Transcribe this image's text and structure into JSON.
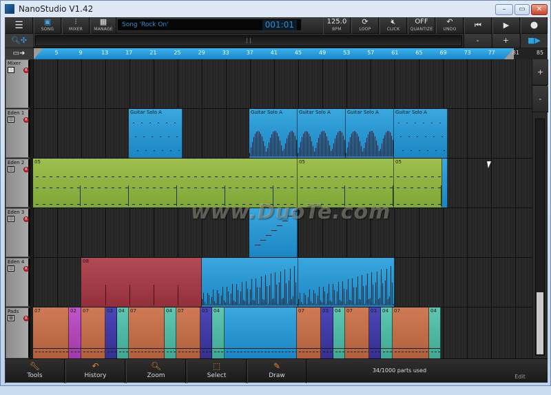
{
  "window": {
    "title": "NanoStudio V1.42",
    "controls": {
      "minimize": "–",
      "maximize": "▭",
      "close": "✕"
    }
  },
  "toolbar": {
    "menu_icon": "☰",
    "song": {
      "icon": "song-icon",
      "label": "SONG"
    },
    "mixer": {
      "icon": "mixer-icon",
      "label": "MIXER"
    },
    "manage": {
      "icon": "manage-icon",
      "label": "MANAGE"
    },
    "song_name": "Song 'Rock On'",
    "position": "001:01",
    "bpm_value": "125.0",
    "bpm_label": "BPM",
    "loop_label": "LOOP",
    "click_label": "CLICK",
    "quantize_value": "OFF",
    "quantize_label": "QUANTIZE",
    "undo_label": "UNDO",
    "transport": {
      "rewind": "⏮",
      "play": "▶",
      "record": "●"
    }
  },
  "row2": {
    "zoom_tool": "zoom-move-icon",
    "minus": "-",
    "plus": "+",
    "follow": "follow-playhead-icon"
  },
  "ruler": {
    "ticks": [
      "5",
      "9",
      "13",
      "17",
      "21",
      "25",
      "29",
      "33",
      "37",
      "41",
      "45",
      "49",
      "53",
      "57",
      "61",
      "65",
      "69",
      "73",
      "77",
      "81",
      "85"
    ]
  },
  "tracks": [
    {
      "name": "Mixer",
      "icon": "mixer",
      "clips": []
    },
    {
      "name": "Eden 1",
      "icon": "keyboard",
      "clips": [
        {
          "label": "Guitar Solo A",
          "color": "blue"
        },
        {
          "label": "Guitar Solo A",
          "color": "blue"
        },
        {
          "label": "Guitar Solo A",
          "color": "blue"
        },
        {
          "label": "Guitar Solo A",
          "color": "blue"
        },
        {
          "label": "Guitar Solo A",
          "color": "blue"
        }
      ]
    },
    {
      "name": "Eden 2",
      "icon": "keyboard",
      "clips": [
        {
          "label": "05",
          "color": "green"
        },
        {
          "label": "05",
          "color": "green"
        },
        {
          "label": "05",
          "color": "green"
        },
        {
          "label": "",
          "color": "blue"
        }
      ]
    },
    {
      "name": "Eden 3",
      "icon": "keyboard",
      "clips": [
        {
          "label": "",
          "color": "blue"
        }
      ]
    },
    {
      "name": "Eden 4",
      "icon": "keyboard",
      "clips": [
        {
          "label": "08",
          "color": "red"
        },
        {
          "label": "",
          "color": "blue"
        },
        {
          "label": "",
          "color": "blue"
        }
      ]
    },
    {
      "name": "Pads",
      "icon": "pads",
      "clips": [
        {
          "label": "07",
          "color": "orange"
        },
        {
          "label": "02",
          "color": "magenta"
        },
        {
          "label": "07",
          "color": "orange"
        },
        {
          "label": "03",
          "color": "indigo"
        },
        {
          "label": "04",
          "color": "teal"
        },
        {
          "label": "07",
          "color": "orange"
        },
        {
          "label": "04",
          "color": "teal"
        },
        {
          "label": "07",
          "color": "orange"
        },
        {
          "label": "03",
          "color": "indigo"
        },
        {
          "label": "04",
          "color": "teal"
        },
        {
          "label": "",
          "color": "blue"
        },
        {
          "label": "07",
          "color": "orange"
        },
        {
          "label": "03",
          "color": "indigo"
        },
        {
          "label": "04",
          "color": "teal"
        },
        {
          "label": "07",
          "color": "orange"
        },
        {
          "label": "03",
          "color": "indigo"
        },
        {
          "label": "04",
          "color": "teal"
        },
        {
          "label": "07",
          "color": "orange"
        },
        {
          "label": "04",
          "color": "teal"
        }
      ]
    }
  ],
  "record_badge": "R",
  "vscroll": {
    "plus": "+",
    "minus": "-"
  },
  "bottom": {
    "tools": "Tools",
    "history": "History",
    "zoom": "Zoom",
    "select": "Select",
    "draw": "Draw",
    "parts_used": "34/1000 parts used",
    "edit": "Edit"
  },
  "watermark": "www.DuoTe.com",
  "colors": {
    "accent": "#2d8fd4",
    "ruler": "#2a9ede",
    "tool_icon": "#e0892b",
    "record": "#c8262b"
  }
}
